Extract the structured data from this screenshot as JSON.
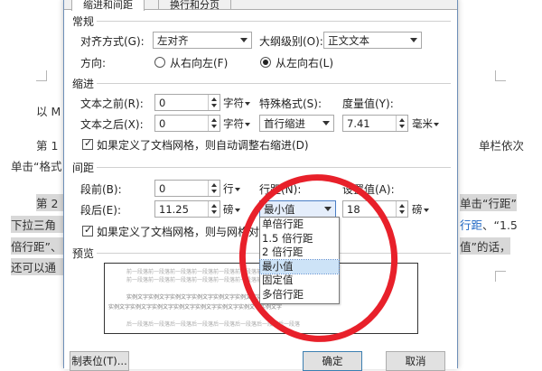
{
  "tabs": [
    {
      "label": "缩进和间距"
    },
    {
      "label": "换行和分页"
    }
  ],
  "general": {
    "title": "常规",
    "alignment_label": "对齐方式(G):",
    "alignment_value": "左对齐",
    "outline_label": "大纲级别(O):",
    "outline_value": "正文文本",
    "direction_label": "方向:",
    "rtl_label": "从右向左(F)",
    "ltr_label": "从左向右(L)"
  },
  "indent": {
    "title": "缩进",
    "before_label": "文本之前(R):",
    "before_value": "0",
    "before_unit": "字符",
    "after_label": "文本之后(X):",
    "after_value": "0",
    "after_unit": "字符",
    "special_label": "特殊格式(S):",
    "special_value": "首行缩进",
    "measure_label": "度量值(Y):",
    "measure_value": "7.41",
    "measure_unit": "毫米",
    "grid_check": "如果定义了文档网格，则自动调整右缩进(D)"
  },
  "spacing": {
    "title": "间距",
    "before_label": "段前(B):",
    "before_value": "0",
    "before_unit": "行",
    "after_label": "段后(E):",
    "after_value": "11.25",
    "after_unit": "磅",
    "line_label": "行距(N):",
    "line_value": "最小值",
    "setting_label": "设置值(A):",
    "setting_value": "18",
    "setting_unit": "磅",
    "grid_check": "如果定义了文档网格，则与网格对齐"
  },
  "line_spacing_options": [
    "单倍行距",
    "1.5 倍行距",
    "2 倍行距",
    "最小值",
    "固定值",
    "多倍行距"
  ],
  "line_spacing_selected": 3,
  "preview": {
    "title": "预览",
    "prev_text": "前一段落前一段落前一段落前一段落前一段落前一段落前一段落前一段落",
    "sample_text": "实例文字实例文字实例文字实例文字实例文字实例文字实例文字实例文字",
    "next_text": "后一段落后一段落后一段落后一段落后一段落后一段落后一段落后一段落"
  },
  "buttons": {
    "tabs": "制表位(T)...",
    "ok": "确定",
    "cancel": "取消"
  },
  "document": {
    "line1": "以 M",
    "line2_a": "第 1",
    "line2_b": "单栏依次",
    "line3": "单击“格式",
    "line4_a": "第 2",
    "line4_b": "单击“行距”",
    "line5_a": "下拉三角",
    "line5_b": "行距",
    "line5_c": "、“1.5",
    "line6_a": "倍行距”、",
    "line6_b": "值”的话，",
    "line7": "还可以通"
  },
  "colors": {
    "annotation": "#e8202a",
    "link_blue": "#1e67c4",
    "selection": "#cde3f7"
  }
}
